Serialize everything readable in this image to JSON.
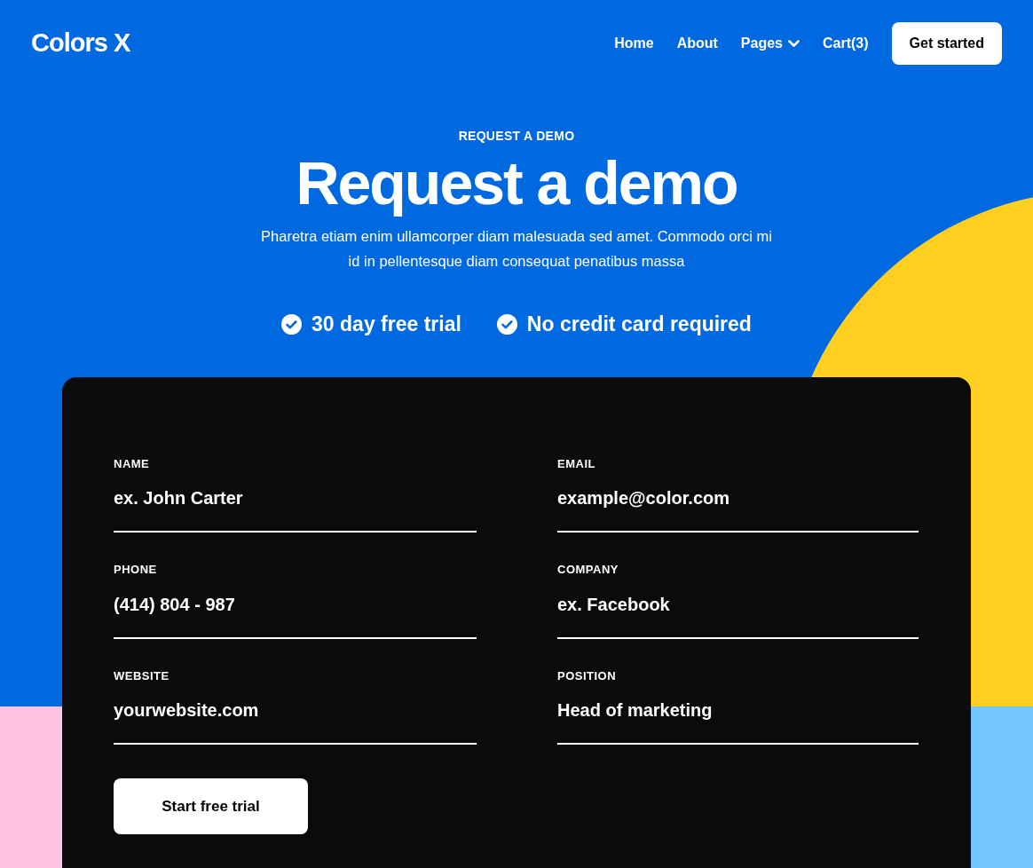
{
  "brand": "Colors X",
  "nav": [
    {
      "label": "Home",
      "kind": "link"
    },
    {
      "label": "About",
      "kind": "link"
    },
    {
      "label": "Pages",
      "kind": "dropdown"
    },
    {
      "label": "Cart(3)",
      "kind": "link"
    }
  ],
  "cta": "Get started",
  "eyebrow": "REQUEST A DEMO",
  "title": "Request a demo",
  "subtitle": "Pharetra etiam enim ullamcorper diam malesuada sed amet. Commodo orci mi id in pellentesque diam consequat penatibus massa",
  "perks": [
    "30 day free trial",
    "No credit card required"
  ],
  "fields": [
    {
      "label": "NAME",
      "placeholder": "ex. John Carter"
    },
    {
      "label": "EMAIL",
      "placeholder": "example@color.com"
    },
    {
      "label": "PHONE",
      "placeholder": "(414) 804 - 987"
    },
    {
      "label": "COMPANY",
      "placeholder": "ex. Facebook"
    },
    {
      "label": "WEBSITE",
      "placeholder": "yourwebsite.com"
    },
    {
      "label": "POSITION",
      "placeholder": "Head of marketing"
    }
  ],
  "submit": "Start free trial"
}
